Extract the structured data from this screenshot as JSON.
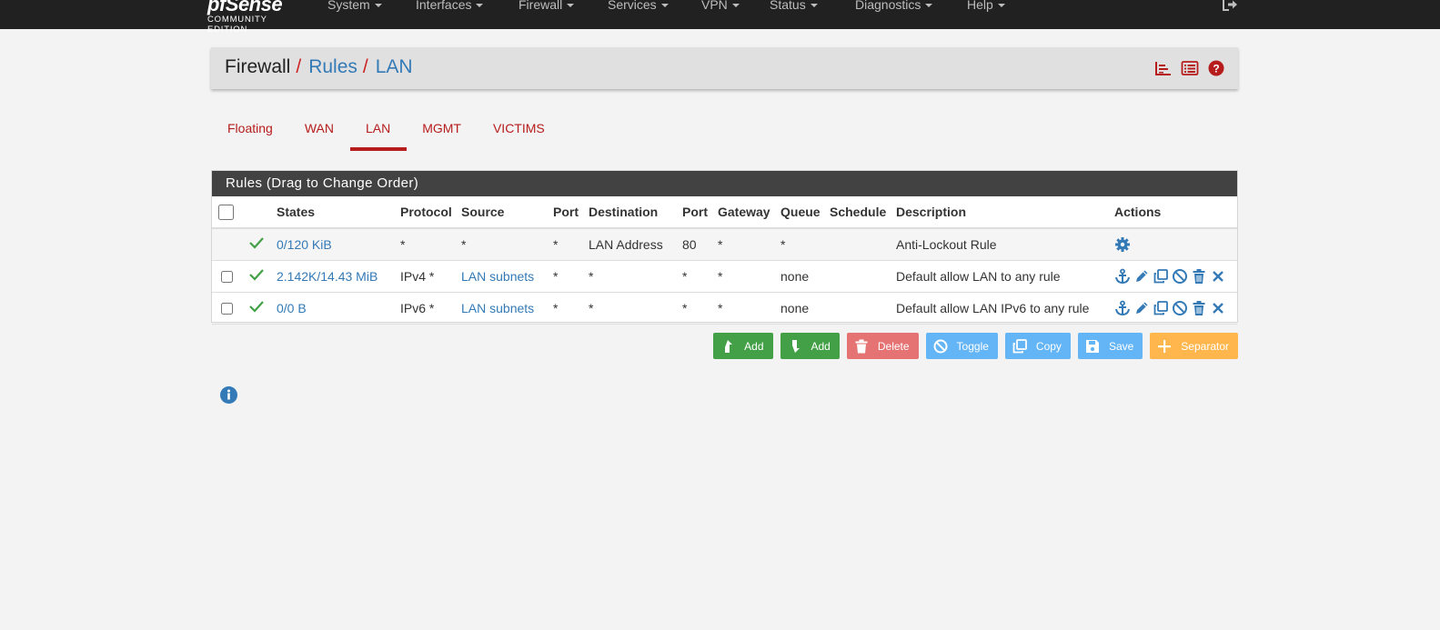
{
  "navbar": {
    "brand": "pfSense",
    "brand_sub": "COMMUNITY EDITION",
    "menu": [
      "System",
      "Interfaces",
      "Firewall",
      "Services",
      "VPN",
      "Status",
      "Diagnostics",
      "Help"
    ]
  },
  "breadcrumb": {
    "root": "Firewall",
    "sep": "/",
    "section": "Rules",
    "page": "LAN"
  },
  "tabs": [
    "Floating",
    "WAN",
    "LAN",
    "MGMT",
    "VICTIMS"
  ],
  "active_tab": "LAN",
  "rules": {
    "heading": "Rules (Drag to Change Order)",
    "columns": [
      "States",
      "Protocol",
      "Source",
      "Port",
      "Destination",
      "Port",
      "Gateway",
      "Queue",
      "Schedule",
      "Description",
      "Actions"
    ],
    "rows": [
      {
        "states": "0/120 KiB",
        "protocol": "*",
        "source": "*",
        "sport": "*",
        "destination": "LAN Address",
        "dport": "80",
        "gateway": "*",
        "queue": "*",
        "schedule": "",
        "description": "Anti-Lockout Rule"
      },
      {
        "states": "2.142K/14.43 MiB",
        "protocol": "IPv4 *",
        "source": "LAN subnets",
        "sport": "*",
        "destination": "*",
        "dport": "*",
        "gateway": "*",
        "queue": "none",
        "schedule": "",
        "description": "Default allow LAN to any rule"
      },
      {
        "states": "0/0 B",
        "protocol": "IPv6 *",
        "source": "LAN subnets",
        "sport": "*",
        "destination": "*",
        "dport": "*",
        "gateway": "*",
        "queue": "none",
        "schedule": "",
        "description": "Default allow LAN IPv6 to any rule"
      }
    ]
  },
  "buttons": {
    "add_top": "Add",
    "add_bottom": "Add",
    "delete": "Delete",
    "toggle": "Toggle",
    "copy": "Copy",
    "save": "Save",
    "separator": "Separator"
  },
  "colors": {
    "accent_red": "#b71c1c",
    "link_blue": "#337ab7",
    "green": "#43a047"
  }
}
